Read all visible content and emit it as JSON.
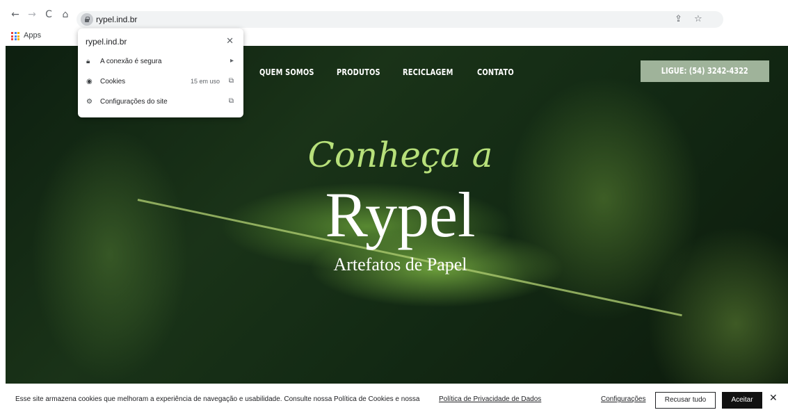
{
  "browser": {
    "url": "rypel.ind.br",
    "back_icon": "←",
    "forward_icon": "→",
    "reload_icon": "C",
    "home_icon": "⌂",
    "share_icon": "⇪",
    "star_icon": "☆",
    "bookmarks": {
      "apps_label": "Apps"
    }
  },
  "site_info_popup": {
    "title": "rypel.ind.br",
    "close_icon": "✕",
    "rows": [
      {
        "label": "A conexão é segura",
        "icon": "lock-icon",
        "action": "▸"
      },
      {
        "label": "Cookies",
        "meta": "15 em uso",
        "icon": "cookie-icon",
        "action": "⧉"
      },
      {
        "label": "Configurações do site",
        "icon": "gear-icon",
        "action": "⧉"
      }
    ]
  },
  "site": {
    "nav": [
      "QUEM SOMOS",
      "PRODUTOS",
      "RECICLAGEM",
      "CONTATO"
    ],
    "cta": "LIGUE: (54) 3242-4322",
    "hero": {
      "line1": "Conheça a",
      "line2": "Rypel",
      "line3": "Artefatos de Papel"
    }
  },
  "cookie_banner": {
    "text": "Esse site armazena cookies que melhoram a experiência de navegação e usabilidade. Consulte nossa Política de Cookies e nossa",
    "privacy_link": "Política de Privacidade de Dados",
    "settings_link": "Configurações",
    "refuse_label": "Recusar tudo",
    "accept_label": "Aceitar",
    "close_icon": "✕"
  }
}
